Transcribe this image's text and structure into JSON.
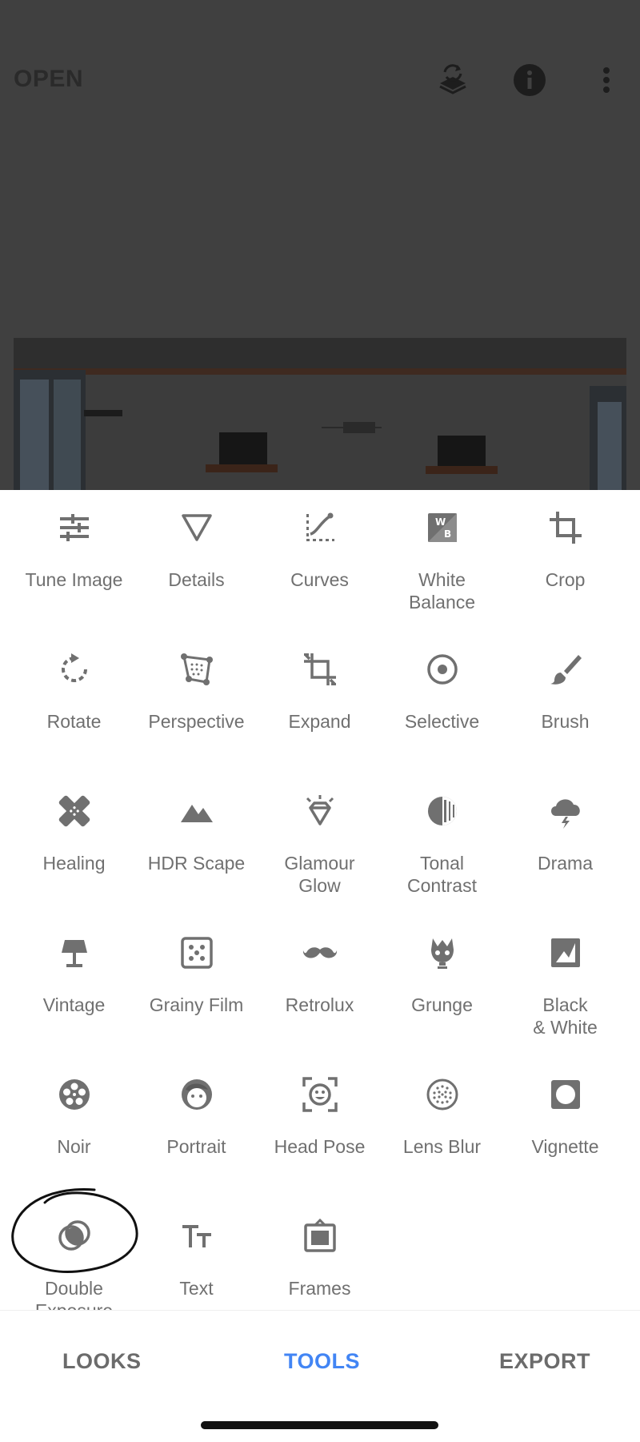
{
  "header": {
    "open_label": "OPEN"
  },
  "tools": [
    {
      "label": "Tune Image",
      "icon": "tune-icon"
    },
    {
      "label": "Details",
      "icon": "details-triangle-icon"
    },
    {
      "label": "Curves",
      "icon": "curves-icon"
    },
    {
      "label": "White\nBalance",
      "icon": "white-balance-icon"
    },
    {
      "label": "Crop",
      "icon": "crop-icon"
    },
    {
      "label": "Rotate",
      "icon": "rotate-icon"
    },
    {
      "label": "Perspective",
      "icon": "perspective-icon"
    },
    {
      "label": "Expand",
      "icon": "expand-icon"
    },
    {
      "label": "Selective",
      "icon": "selective-icon"
    },
    {
      "label": "Brush",
      "icon": "brush-icon"
    },
    {
      "label": "Healing",
      "icon": "healing-bandage-icon"
    },
    {
      "label": "HDR Scape",
      "icon": "mountains-icon"
    },
    {
      "label": "Glamour\nGlow",
      "icon": "diamond-icon"
    },
    {
      "label": "Tonal\nContrast",
      "icon": "tonal-contrast-icon"
    },
    {
      "label": "Drama",
      "icon": "storm-cloud-icon"
    },
    {
      "label": "Vintage",
      "icon": "lamp-icon"
    },
    {
      "label": "Grainy Film",
      "icon": "grain-icon"
    },
    {
      "label": "Retrolux",
      "icon": "mustache-icon"
    },
    {
      "label": "Grunge",
      "icon": "grunge-icon"
    },
    {
      "label": "Black\n& White",
      "icon": "black-white-photo-icon"
    },
    {
      "label": "Noir",
      "icon": "film-reel-icon"
    },
    {
      "label": "Portrait",
      "icon": "face-icon"
    },
    {
      "label": "Head Pose",
      "icon": "head-pose-icon"
    },
    {
      "label": "Lens Blur",
      "icon": "lens-blur-icon"
    },
    {
      "label": "Vignette",
      "icon": "vignette-icon"
    },
    {
      "label": "Double\nExposure",
      "icon": "double-exposure-icon"
    },
    {
      "label": "Text",
      "icon": "text-icon"
    },
    {
      "label": "Frames",
      "icon": "frames-icon"
    }
  ],
  "nav": {
    "looks": "LOOKS",
    "tools": "TOOLS",
    "export": "EXPORT",
    "active": "TOOLS"
  },
  "colors": {
    "accent": "#4285f4",
    "icon": "#707070",
    "nav_inactive": "#6b6b6b",
    "dim_overlay": "#404040"
  }
}
